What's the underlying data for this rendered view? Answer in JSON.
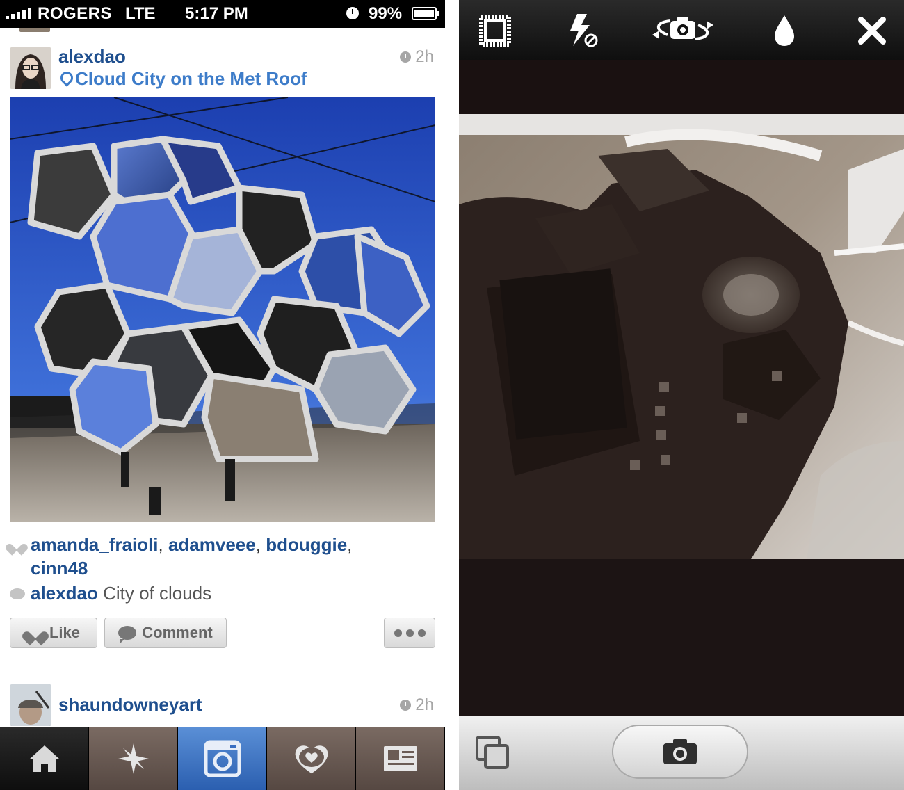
{
  "left_phone": {
    "status_bar": {
      "carrier": "ROGERS",
      "network": "LTE",
      "time": "5:17 PM",
      "battery": "99%"
    },
    "posts": [
      {
        "username": "alexdao",
        "location": "Cloud City on the Met Roof",
        "time_ago": "2h",
        "likers": [
          "amanda_fraioli",
          "adamveee",
          "bdouggie",
          "cinn48"
        ],
        "caption_user": "alexdao",
        "caption_text": "City of clouds"
      },
      {
        "username": "shaundowneyart",
        "time_ago": "2h"
      }
    ],
    "actions": {
      "like_label": "Like",
      "comment_label": "Comment"
    },
    "tabs": [
      {
        "icon": "home-icon",
        "active": true
      },
      {
        "icon": "explore-icon"
      },
      {
        "icon": "camera-icon"
      },
      {
        "icon": "news-icon"
      },
      {
        "icon": "profile-icon"
      }
    ]
  },
  "right_phone": {
    "toolbar_icons": [
      "grid-icon",
      "flash-off-icon",
      "flip-camera-icon",
      "blur-icon",
      "close-icon"
    ],
    "bottom_icons": [
      "gallery-icon",
      "shutter-camera-icon"
    ]
  },
  "colors": {
    "username_blue": "#1f4f8e",
    "location_blue": "#3d7cc9",
    "camera_tab": "#3a6fc2"
  }
}
